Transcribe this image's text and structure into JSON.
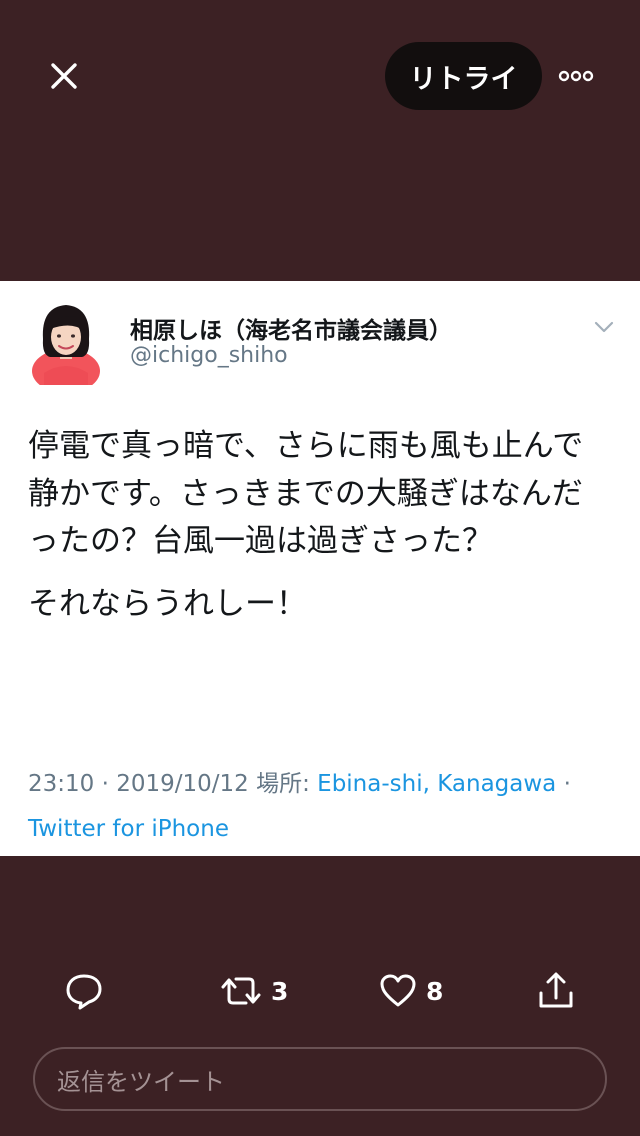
{
  "header": {
    "retweet_label": "リトライ"
  },
  "tweet": {
    "display_name": "相原しほ（海老名市議会議員）",
    "handle": "@ichigo_shiho",
    "paragraphs": [
      "停電で真っ暗で、さらに雨も風も止んで静かです。さっきまでの大騒ぎはなんだったの？台風一過は過ぎさった？",
      "それならうれしー！"
    ],
    "timestamp": "23:10 · 2019/10/12",
    "location_label": "場所:",
    "location": "Ebina-shi, Kanagawa",
    "separator": "·",
    "source": "Twitter for iPhone"
  },
  "actions": {
    "retweet_count": "3",
    "like_count": "8"
  },
  "reply": {
    "placeholder": "返信をツイート"
  },
  "colors": {
    "background": "#3c2124",
    "card": "#ffffff",
    "link": "#1b95e0",
    "muted": "#657786"
  }
}
